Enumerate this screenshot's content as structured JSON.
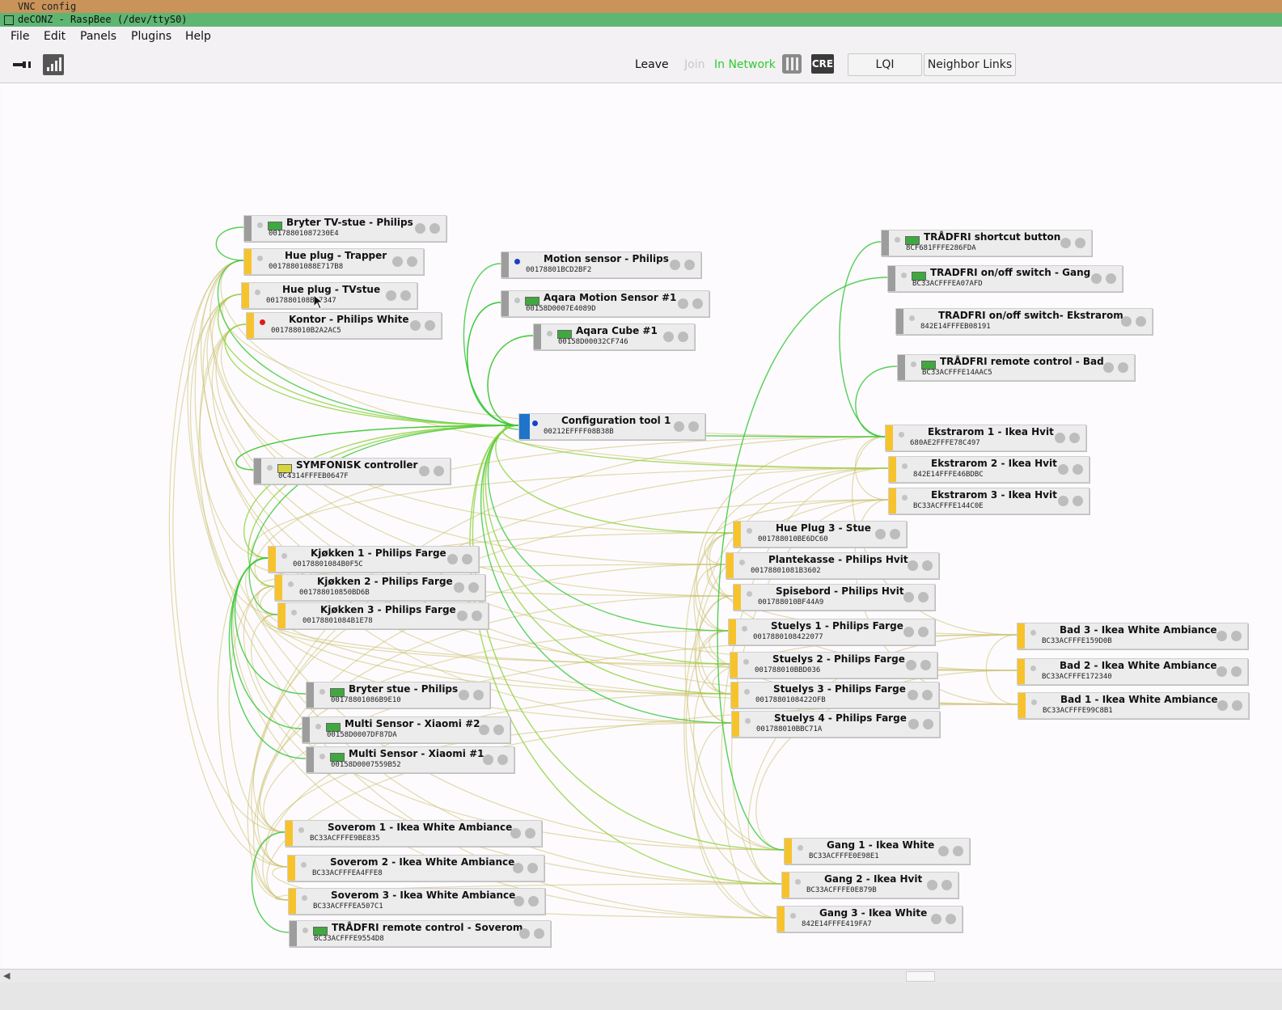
{
  "vnc": {
    "title": "VNC config"
  },
  "window": {
    "title": "deCONZ - RaspBee (/dev/ttyS0)"
  },
  "menu": [
    "File",
    "Edit",
    "Panels",
    "Plugins",
    "Help"
  ],
  "toolbar": {
    "leave": "Leave",
    "join": "Join",
    "status": "In Network",
    "cre": "CRE",
    "lqi": "LQI",
    "neighbor_links": "Neighbor Links"
  },
  "colors": {
    "router": "#f7c32d",
    "end_device": "#9d9d9d",
    "coordinator": "#1f74c9",
    "link_strong": "#37c83a",
    "link_weak": "#c9c06a"
  },
  "nodes": [
    {
      "name": "Bryter TV-stue - Philips",
      "mac": "00178801087230E4"
    },
    {
      "name": "Hue plug - Trapper",
      "mac": "00178801088E717B8"
    },
    {
      "name": "Hue plug - TVstue",
      "mac": "0017880108B07347"
    },
    {
      "name": "Kontor - Philips White",
      "mac": "001788010B2A2AC5"
    },
    {
      "name": "Motion sensor - Philips",
      "mac": "00178801BCD2BF2"
    },
    {
      "name": "Aqara Motion Sensor #1",
      "mac": "00158D0007E4089D"
    },
    {
      "name": "Aqara Cube #1",
      "mac": "00158D00032CF746"
    },
    {
      "name": "TRÅDFRI shortcut button",
      "mac": "8CF681FFFE286FDA"
    },
    {
      "name": "TRADFRI on/off switch - Gang",
      "mac": "BC33ACFFFEA07AFD"
    },
    {
      "name": "TRADFRI on/off switch- Ekstrarom",
      "mac": "842E14FFFEB08191"
    },
    {
      "name": "TRÅDFRI remote control - Bad",
      "mac": "BC33ACFFFE14AAC5"
    },
    {
      "name": "Configuration tool 1",
      "mac": "00212EFFFF08B38B"
    },
    {
      "name": "SYMFONISK controller",
      "mac": "0C4314FFFEB0647F"
    },
    {
      "name": "Ekstrarom 1 - Ikea Hvit",
      "mac": "680AE2FFFE78C497"
    },
    {
      "name": "Ekstrarom 2 - Ikea Hvit",
      "mac": "842E14FFFE46BDBC"
    },
    {
      "name": "Ekstrarom 3 - Ikea Hvit",
      "mac": "BC33ACFFFE144C0E"
    },
    {
      "name": "Hue Plug 3 - Stue",
      "mac": "001788010BE6DC60"
    },
    {
      "name": "Plantekasse - Philips Hvit",
      "mac": "00178801081B3602"
    },
    {
      "name": "Spisebord - Philips Hvit",
      "mac": "001788010BF44A9"
    },
    {
      "name": "Stuelys 1 - Philips Farge",
      "mac": "0017880108422077"
    },
    {
      "name": "Stuelys 2 - Philips Farge",
      "mac": "001788010BBD036"
    },
    {
      "name": "Stuelys 3 - Philips Farge",
      "mac": "0017880108422OFB"
    },
    {
      "name": "Stuelys 4 - Philips Farge",
      "mac": "001788010BBC71A"
    },
    {
      "name": "Bad 3 - Ikea White Ambiance",
      "mac": "BC33ACFFFE159D0B"
    },
    {
      "name": "Bad 2 - Ikea White Ambiance",
      "mac": "BC33ACFFFE172340"
    },
    {
      "name": "Bad 1 - Ikea White Ambiance",
      "mac": "BC33ACFFFE99C8B1"
    },
    {
      "name": "Kjøkken 1 - Philips Farge",
      "mac": "00178801084B0F5C"
    },
    {
      "name": "Kjøkken 2 - Philips Farge",
      "mac": "001788010850BD6B"
    },
    {
      "name": "Kjøkken 3 - Philips Farge",
      "mac": "00178801084B1E78"
    },
    {
      "name": "Bryter stue - Philips",
      "mac": "00178801086B9E10"
    },
    {
      "name": "Multi Sensor - Xiaomi #2",
      "mac": "00158D0007DF87DA"
    },
    {
      "name": "Multi Sensor - Xiaomi #1",
      "mac": "00158D0007559B52"
    },
    {
      "name": "Soverom 1 - Ikea White Ambiance",
      "mac": "BC33ACFFFE9BE835"
    },
    {
      "name": "Soverom 2 - Ikea White Ambiance",
      "mac": "BC33ACFFFEA4FFE8"
    },
    {
      "name": "Soverom 3 - Ikea White Ambiance",
      "mac": "BC33ACFFFEA507C1"
    },
    {
      "name": "TRÅDFRI remote control - Soverom",
      "mac": "BC33ACFFFE9554D8"
    },
    {
      "name": "Gang 1 - Ikea White",
      "mac": "BC33ACFFFE0E98E1"
    },
    {
      "name": "Gang 2 - Ikea Hvit",
      "mac": "BC33ACFFFE0E879B"
    },
    {
      "name": "Gang 3 - Ikea White",
      "mac": "842E14FFFE419FA7"
    }
  ]
}
